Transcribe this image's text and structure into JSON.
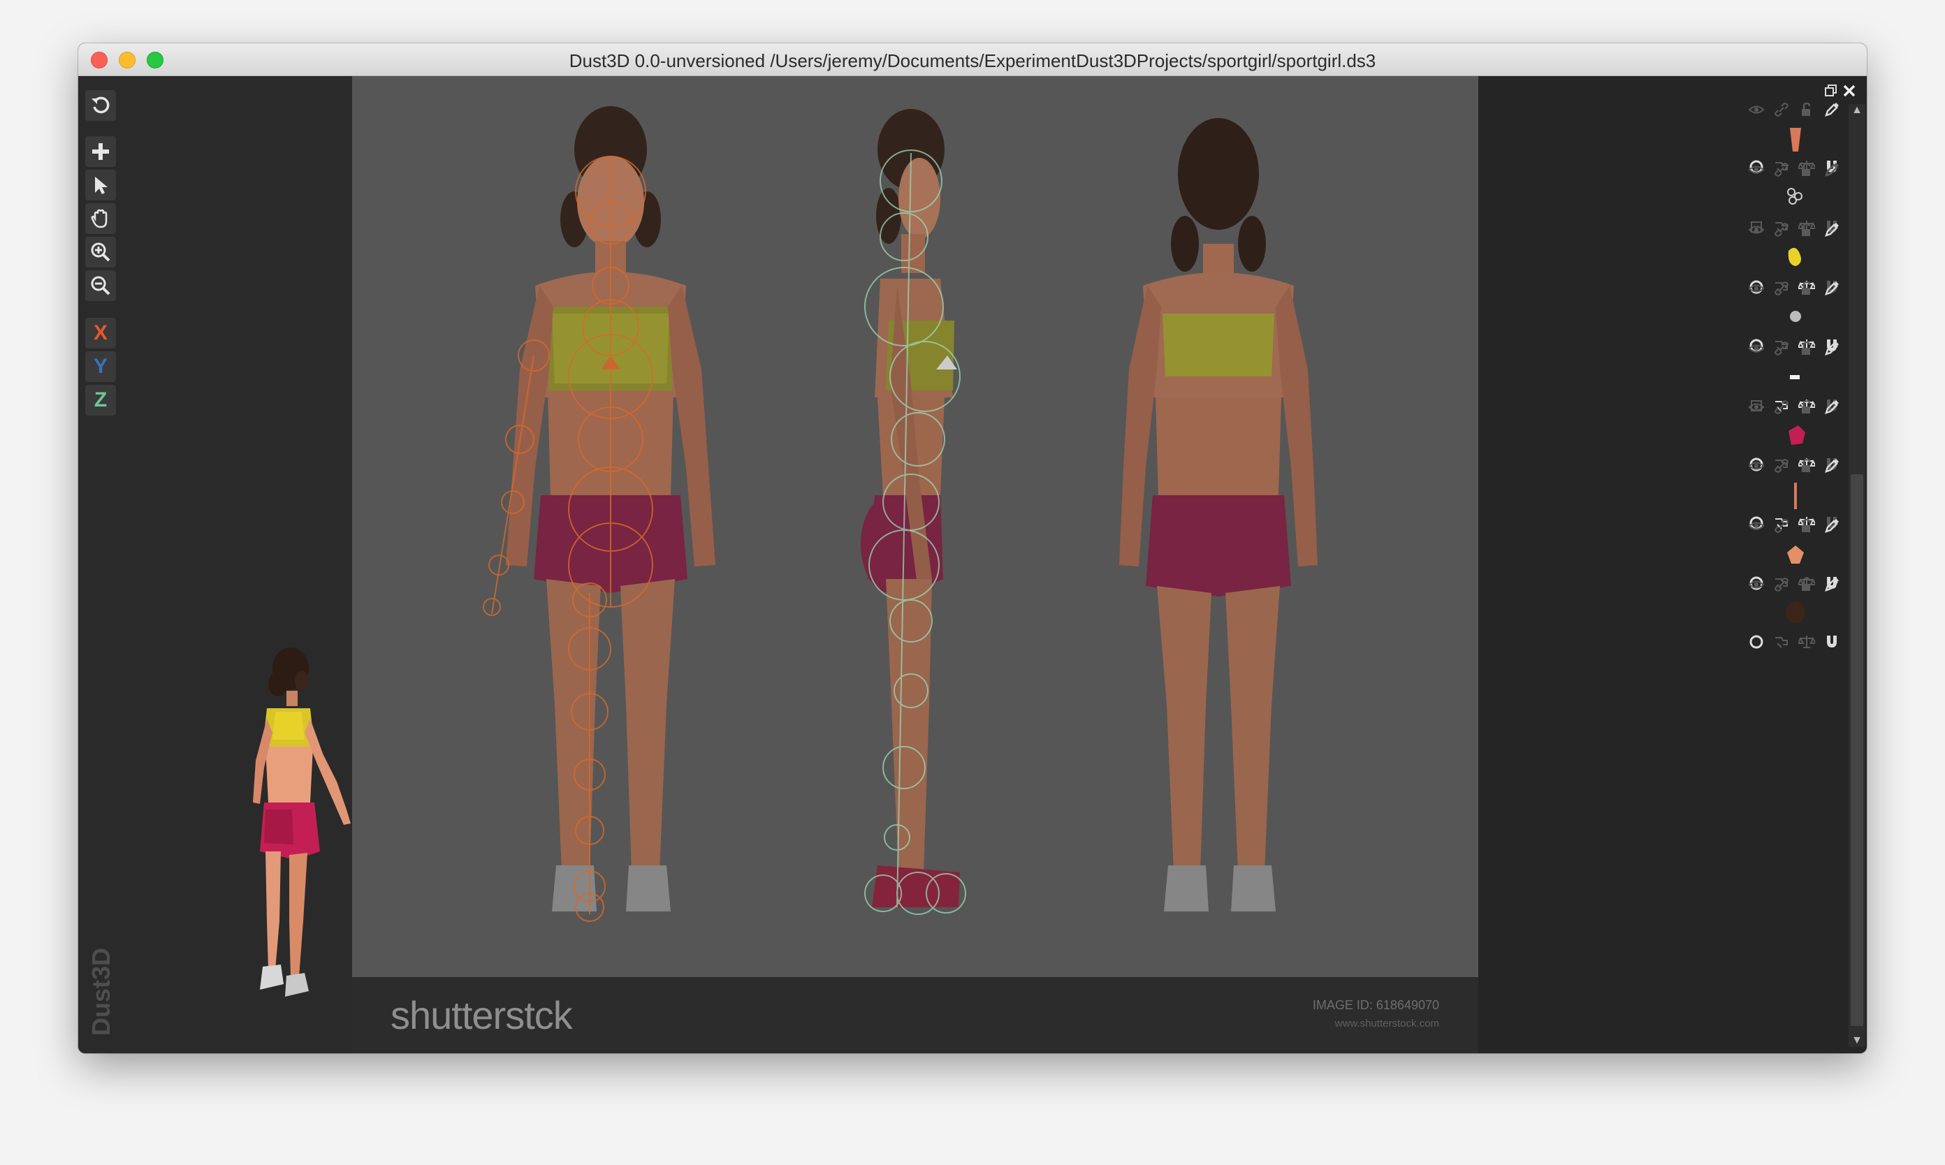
{
  "window": {
    "title": "Dust3D 0.0-unversioned /Users/jeremy/Documents/ExperimentDust3DProjects/sportgirl/sportgirl.ds3"
  },
  "toolbar": {
    "items": [
      {
        "name": "undo-icon"
      },
      {
        "name": "add-icon"
      },
      {
        "name": "select-icon"
      },
      {
        "name": "drag-hand-icon"
      },
      {
        "name": "zoom-in-icon"
      },
      {
        "name": "zoom-out-icon"
      }
    ],
    "x_label": "X",
    "y_label": "Y",
    "z_label": "Z",
    "x_color": "#e8582a",
    "y_color": "#3e6fb8",
    "z_color": "#6ec79a"
  },
  "brand": "Dust3D",
  "footer": {
    "logo_text": "shutterstck",
    "image_id": "IMAGE ID: 618649070",
    "url": "www.shutterstock.com"
  },
  "parts": [
    {
      "thumb_color": "#d9795a",
      "selected": false
    },
    {
      "thumb_color": "#3a3a3a",
      "selected": false
    },
    {
      "thumb_color": "#e8d22a",
      "selected": false
    },
    {
      "thumb_color": "#bdbdbd",
      "selected": false
    },
    {
      "thumb_color": "#f2f2f2",
      "selected": false
    },
    {
      "thumb_color": "#c31f55",
      "selected": false
    },
    {
      "thumb_color": "#d9795a",
      "selected": false
    },
    {
      "thumb_color": "#e48f68",
      "selected": false
    },
    {
      "thumb_color": "#3b2418",
      "selected": false
    }
  ]
}
